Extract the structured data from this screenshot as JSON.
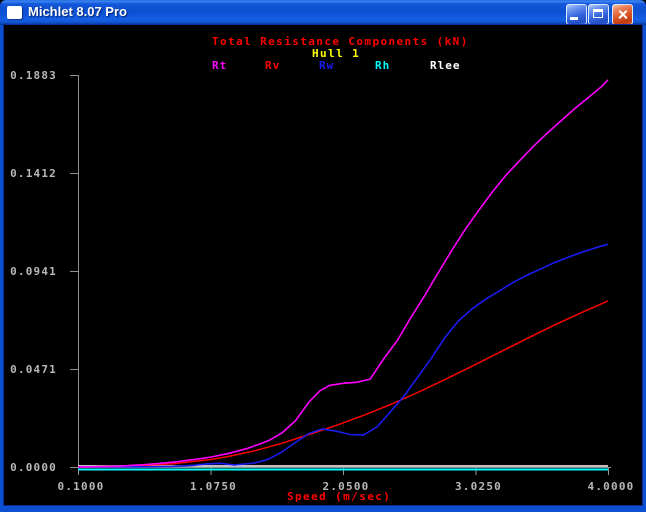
{
  "window": {
    "title": "Michlet 8.07 Pro",
    "controls": [
      "minimize-icon",
      "maximize-icon",
      "close-icon"
    ]
  },
  "chart_data": {
    "type": "line",
    "title": "Total Resistance Components (kN)",
    "title_color": "#ff0000",
    "subtitle": "Hull 1",
    "subtitle_color": "#ffff00",
    "xlabel": "Speed (m/sec)",
    "xlabel_color": "#ff0000",
    "ylabel": "",
    "x_range": [
      0.1,
      4.0
    ],
    "y_range": [
      0.0,
      0.1883
    ],
    "grid": false,
    "legend_position": "top",
    "background_color": "#000000",
    "axis_color": "#909090",
    "tick_label_color": "#b8b8b8",
    "x_ticks": [
      {
        "label": "0.1000",
        "value": 0.1
      },
      {
        "label": "1.0750",
        "value": 1.075
      },
      {
        "label": "2.0500",
        "value": 2.05
      },
      {
        "label": "3.0250",
        "value": 3.025
      },
      {
        "label": "4.0000",
        "value": 4.0
      }
    ],
    "y_ticks": [
      {
        "label": "0.1883",
        "value": 0.1883
      },
      {
        "label": "0.1412",
        "value": 0.1412
      },
      {
        "label": "0.0941",
        "value": 0.0941
      },
      {
        "label": "0.0471",
        "value": 0.0471
      },
      {
        "label": "0.0000",
        "value": 0.0
      }
    ],
    "series": [
      {
        "name": "Rt",
        "color": "#ff00ff",
        "points": [
          [
            0.1,
            0.0
          ],
          [
            0.4,
            0.0004
          ],
          [
            0.6,
            0.0012
          ],
          [
            0.8,
            0.0023
          ],
          [
            1.0,
            0.004
          ],
          [
            1.08,
            0.0048
          ],
          [
            1.2,
            0.0064
          ],
          [
            1.35,
            0.009
          ],
          [
            1.5,
            0.0126
          ],
          [
            1.6,
            0.0163
          ],
          [
            1.7,
            0.0222
          ],
          [
            1.8,
            0.0312
          ],
          [
            1.88,
            0.0366
          ],
          [
            1.95,
            0.0392
          ],
          [
            2.05,
            0.0402
          ],
          [
            2.15,
            0.0407
          ],
          [
            2.25,
            0.0422
          ],
          [
            2.35,
            0.052
          ],
          [
            2.45,
            0.0608
          ],
          [
            2.55,
            0.0718
          ],
          [
            2.65,
            0.0822
          ],
          [
            2.75,
            0.0932
          ],
          [
            2.85,
            0.104
          ],
          [
            2.95,
            0.1142
          ],
          [
            3.05,
            0.1234
          ],
          [
            3.15,
            0.1322
          ],
          [
            3.25,
            0.1402
          ],
          [
            3.35,
            0.1472
          ],
          [
            3.45,
            0.154
          ],
          [
            3.55,
            0.1602
          ],
          [
            3.65,
            0.166
          ],
          [
            3.75,
            0.1718
          ],
          [
            3.85,
            0.1772
          ],
          [
            3.95,
            0.1826
          ],
          [
            4.0,
            0.186
          ]
        ]
      },
      {
        "name": "Rv",
        "color": "#ff0000",
        "points": [
          [
            0.1,
            0.0
          ],
          [
            0.4,
            0.0003
          ],
          [
            0.6,
            0.0008
          ],
          [
            0.8,
            0.0016
          ],
          [
            1.0,
            0.003
          ],
          [
            1.08,
            0.0036
          ],
          [
            1.2,
            0.005
          ],
          [
            1.4,
            0.0078
          ],
          [
            1.6,
            0.0114
          ],
          [
            1.8,
            0.0156
          ],
          [
            2.0,
            0.02
          ],
          [
            2.2,
            0.0248
          ],
          [
            2.4,
            0.03
          ],
          [
            2.6,
            0.0358
          ],
          [
            2.8,
            0.042
          ],
          [
            3.0,
            0.0484
          ],
          [
            3.2,
            0.055
          ],
          [
            3.4,
            0.0616
          ],
          [
            3.6,
            0.068
          ],
          [
            3.8,
            0.074
          ],
          [
            4.0,
            0.0798
          ]
        ]
      },
      {
        "name": "Rw",
        "color": "#1b1bf0",
        "points": [
          [
            0.1,
            0.0
          ],
          [
            0.6,
            0.0001
          ],
          [
            0.8,
            0.0003
          ],
          [
            0.95,
            0.0008
          ],
          [
            1.05,
            0.0015
          ],
          [
            1.15,
            0.0018
          ],
          [
            1.25,
            0.0009
          ],
          [
            1.4,
            0.0019
          ],
          [
            1.5,
            0.0037
          ],
          [
            1.6,
            0.0072
          ],
          [
            1.7,
            0.0118
          ],
          [
            1.8,
            0.0161
          ],
          [
            1.9,
            0.0183
          ],
          [
            2.0,
            0.0172
          ],
          [
            2.1,
            0.0156
          ],
          [
            2.2,
            0.0153
          ],
          [
            2.3,
            0.0192
          ],
          [
            2.4,
            0.0266
          ],
          [
            2.5,
            0.0342
          ],
          [
            2.6,
            0.0432
          ],
          [
            2.7,
            0.0522
          ],
          [
            2.8,
            0.0622
          ],
          [
            2.9,
            0.0702
          ],
          [
            3.0,
            0.076
          ],
          [
            3.1,
            0.0806
          ],
          [
            3.2,
            0.0846
          ],
          [
            3.3,
            0.0886
          ],
          [
            3.4,
            0.092
          ],
          [
            3.5,
            0.095
          ],
          [
            3.6,
            0.098
          ],
          [
            3.7,
            0.1006
          ],
          [
            3.8,
            0.103
          ],
          [
            3.9,
            0.1051
          ],
          [
            4.0,
            0.107
          ]
        ]
      },
      {
        "name": "Rh",
        "color": "#00ffff",
        "points": [
          [
            0.1,
            0.0
          ],
          [
            4.0,
            0.0
          ]
        ]
      },
      {
        "name": "Rlee",
        "color": "#ffffff",
        "points": [
          [
            0.1,
            0.0
          ],
          [
            4.0,
            0.0
          ]
        ]
      }
    ]
  }
}
